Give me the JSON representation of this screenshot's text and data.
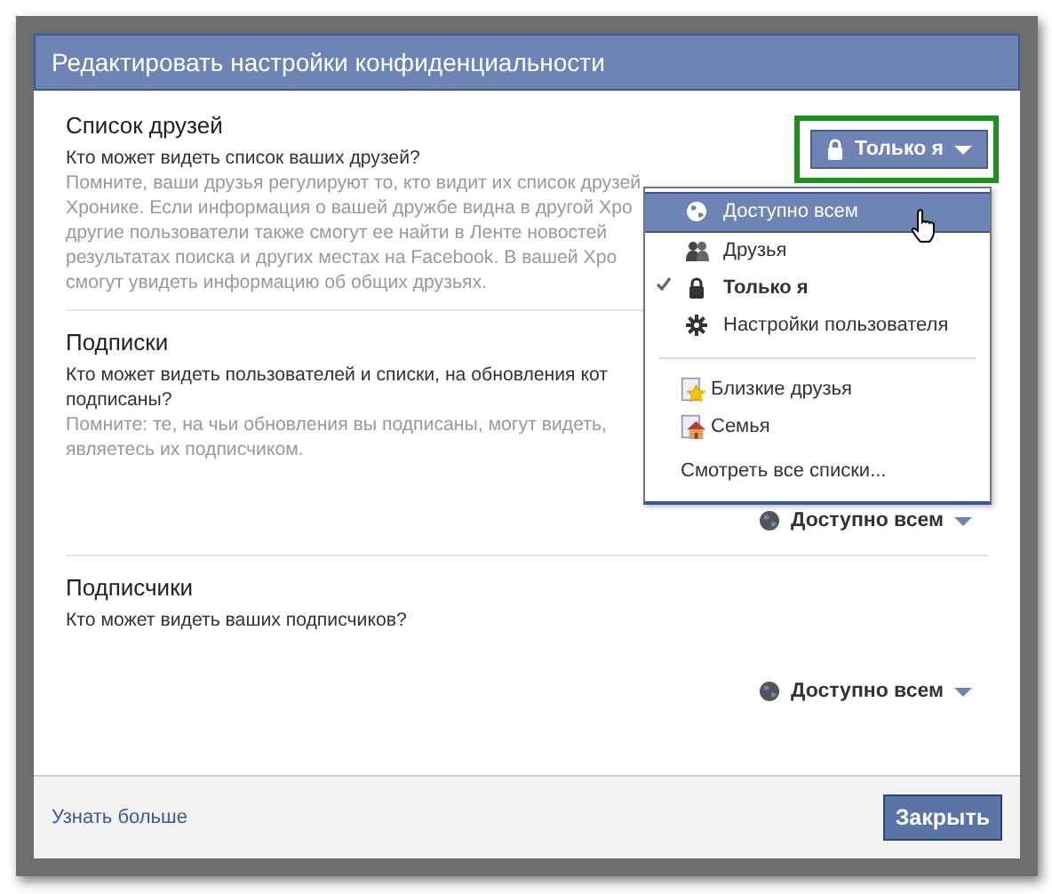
{
  "dialog": {
    "title": "Редактировать настройки конфиденциальности"
  },
  "sections": [
    {
      "heading": "Список друзей",
      "question_lines": [
        "Кто может видеть список ваших друзей?"
      ],
      "note_lines": [
        "Помните, ваши друзья регулируют то, кто видит их список друзей",
        "Хронике. Если информация о вашей дружбе видна в другой Хро",
        "другие пользователи также смогут ее найти в Ленте новостей",
        "результатах поиска и других местах на Facebook. В вашей Хро",
        "смогут увидеть информацию об общих друзьях."
      ],
      "audience": {
        "label": "Только я",
        "open": true,
        "highlighted": true
      }
    },
    {
      "heading": "Подписки",
      "question_lines": [
        "Кто может видеть пользователей и списки, на обновления кот",
        "подписаны?"
      ],
      "note_lines": [
        "Помните: те, на чьи обновления вы подписаны, могут видеть,",
        "являетесь их подписчиком."
      ],
      "audience": {
        "label": "Доступно всем",
        "open": false
      }
    },
    {
      "heading": "Подписчики",
      "question_lines": [
        "Кто может видеть ваших подписчиков?"
      ],
      "audience": {
        "label": "Доступно всем",
        "open": false
      }
    }
  ],
  "menu": {
    "items": [
      {
        "kind": "option",
        "label": "Доступно всем",
        "selected": true,
        "checked": false
      },
      {
        "kind": "option",
        "label": "Друзья",
        "selected": false,
        "checked": false
      },
      {
        "kind": "option",
        "label": "Только я",
        "selected": false,
        "checked": true
      },
      {
        "kind": "option",
        "label": "Настройки пользователя",
        "selected": false,
        "checked": false
      },
      {
        "kind": "separator"
      },
      {
        "kind": "list",
        "label": "Близкие друзья",
        "selected": false,
        "checked": false
      },
      {
        "kind": "list",
        "label": "Семья",
        "selected": false,
        "checked": false
      },
      {
        "kind": "link",
        "label": "Смотреть все списки...",
        "selected": false,
        "checked": false
      }
    ]
  },
  "footer": {
    "link": "Узнать больше",
    "button": "Закрыть"
  }
}
